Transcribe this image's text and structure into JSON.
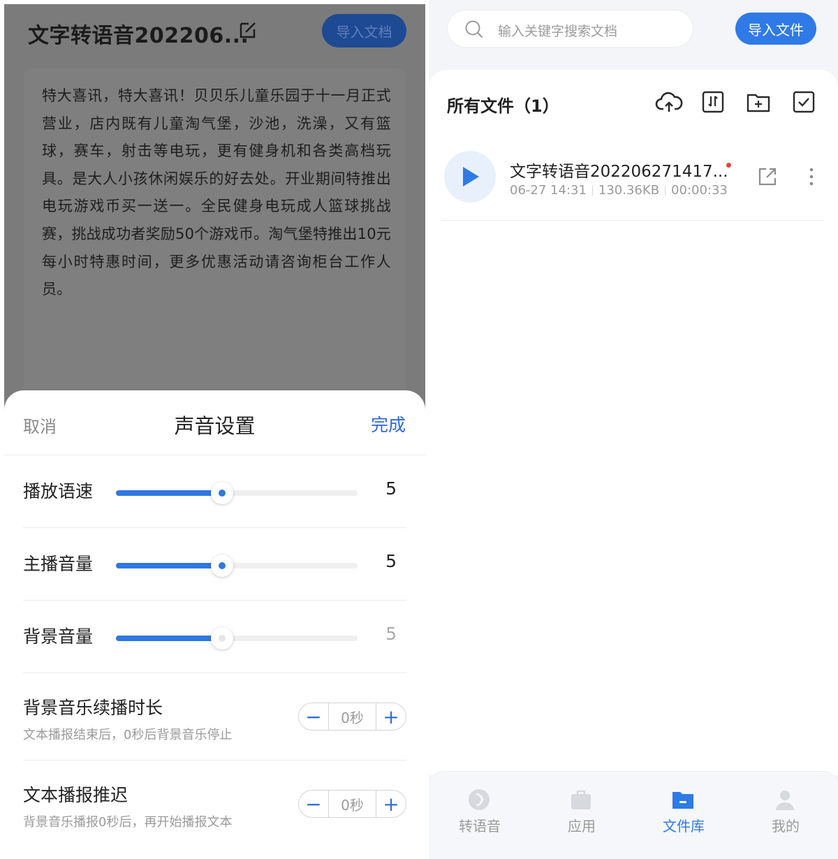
{
  "editor": {
    "doc_title": "文字转语音202206...",
    "import_doc_label": "导入文档",
    "body_text": "特大喜讯，特大喜讯！贝贝乐儿童乐园于十一月正式营业，店内既有儿童淘气堡，沙池，洗澡，又有篮球，赛车，射击等电玩，更有健身机和各类高档玩具。是大人小孩休闲娱乐的好去处。开业期间特推出电玩游戏币买一送一。全民健身电玩成人篮球挑战赛，挑战成功者奖励50个游戏币。淘气堡特推出10元每小时特惠时间，更多优惠活动请咨询柜台工作人员。"
  },
  "sound_settings": {
    "cancel_label": "取消",
    "title": "声音设置",
    "done_label": "完成",
    "sliders": [
      {
        "label": "播放语速",
        "value": "5",
        "fraction": 0.44,
        "enabled": true
      },
      {
        "label": "主播音量",
        "value": "5",
        "fraction": 0.44,
        "enabled": true
      },
      {
        "label": "背景音量",
        "value": "5",
        "fraction": 0.44,
        "enabled": false
      }
    ],
    "steppers": [
      {
        "title": "背景音乐续播时长",
        "desc": "文本播报结束后，0秒后背景音乐停止",
        "value": "0秒",
        "minus": "−",
        "plus": "+"
      },
      {
        "title": "文本播报推迟",
        "desc": "背景音乐播报0秒后，再开始播报文本",
        "value": "0秒",
        "minus": "−",
        "plus": "+"
      }
    ]
  },
  "library": {
    "search_placeholder": "输入关键字搜索文档",
    "import_file_label": "导入文件",
    "heading": "所有文件（1）",
    "toolbar_icons": [
      "cloud-upload-icon",
      "sort-icon",
      "new-folder-icon",
      "select-icon"
    ],
    "files": [
      {
        "name": "文字转语音202206271417...",
        "date": "06-27 14:31",
        "size": "130.36KB",
        "duration": "00:00:33",
        "is_new": true
      }
    ]
  },
  "tabbar": {
    "tabs": [
      {
        "label": "转语音",
        "icon": "voice-icon",
        "active": false
      },
      {
        "label": "应用",
        "icon": "briefcase-icon",
        "active": false
      },
      {
        "label": "文件库",
        "icon": "folder-icon",
        "active": true
      },
      {
        "label": "我的",
        "icon": "person-icon",
        "active": false
      }
    ]
  },
  "colors": {
    "accent": "#2f7ae6",
    "overlay": "#7b7b7b",
    "new_dot": "#e84040"
  }
}
